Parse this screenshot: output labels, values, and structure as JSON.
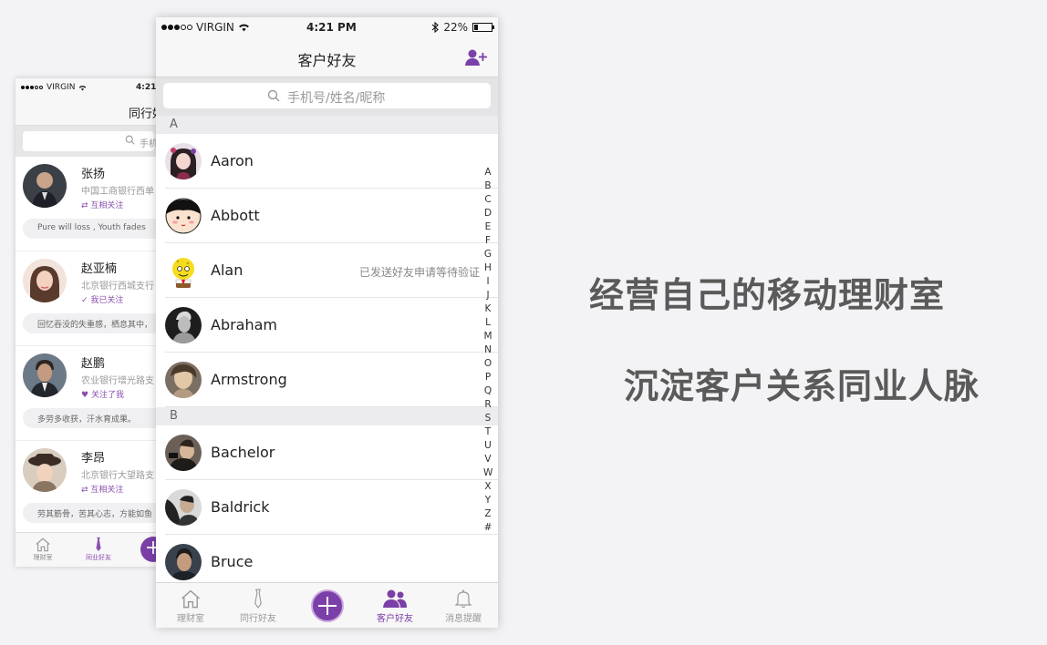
{
  "back_phone": {
    "status": {
      "carrier": "VIRGIN",
      "time": "4:21"
    },
    "nav_title": "同行好",
    "search_placeholder": "手机号",
    "friends": [
      {
        "name": "张扬",
        "company": "中国工商银行西单",
        "relation": "互相关注",
        "quote": "Pure will loss ,  Youth fades"
      },
      {
        "name": "赵亚楠",
        "company": "北京银行西城支行",
        "relation": "我已关注",
        "quote": "回忆吞没的失重感，栖息其中，"
      },
      {
        "name": "赵鹏",
        "company": "农业银行增光路支",
        "relation": "关注了我",
        "quote": "多劳多收获，汗水育成果。"
      },
      {
        "name": "李昂",
        "company": "北京银行大望路支",
        "relation": "互相关注",
        "quote": "劳其筋骨，苦其心志，方能如鱼"
      }
    ],
    "tabs": [
      {
        "label": "理财室",
        "icon": "home-icon"
      },
      {
        "label": "同业好友",
        "icon": "tie-icon"
      }
    ]
  },
  "front_phone": {
    "status": {
      "carrier": "VIRGIN",
      "time": "4:21 PM",
      "battery": "22%",
      "battery_level": 0.22
    },
    "nav": {
      "title": "客户好友",
      "action_icon": "add-person-icon"
    },
    "search": {
      "placeholder": "手机号/姓名/昵称",
      "icon": "search-icon"
    },
    "sections": [
      {
        "letter": "A",
        "contacts": [
          {
            "name": "Aaron",
            "status": ""
          },
          {
            "name": "Abbott",
            "status": ""
          },
          {
            "name": "Alan",
            "status": "已发送好友申请等待验证"
          },
          {
            "name": "Abraham",
            "status": ""
          },
          {
            "name": "Armstrong",
            "status": ""
          }
        ]
      },
      {
        "letter": "B",
        "contacts": [
          {
            "name": "Bachelor",
            "status": ""
          },
          {
            "name": "Baldrick",
            "status": ""
          },
          {
            "name": "Bruce",
            "status": ""
          }
        ]
      }
    ],
    "index_letters": [
      "A",
      "B",
      "C",
      "D",
      "E",
      "F",
      "G",
      "H",
      "I",
      "J",
      "K",
      "L",
      "M",
      "N",
      "O",
      "P",
      "Q",
      "R",
      "S",
      "T",
      "U",
      "V",
      "W",
      "X",
      "Y",
      "Z",
      "#"
    ],
    "tabs": [
      {
        "label": "理财室",
        "icon": "home-icon"
      },
      {
        "label": "同行好友",
        "icon": "tie-icon"
      },
      {
        "label": "",
        "icon": "plus-icon"
      },
      {
        "label": "客户好友",
        "icon": "people-icon"
      },
      {
        "label": "消息提醒",
        "icon": "bell-icon"
      }
    ],
    "accent_color": "#7b3fa8"
  },
  "slogans": {
    "line1": "经营自己的移动理财室",
    "line2": "沉淀客户关系同业人脉"
  }
}
